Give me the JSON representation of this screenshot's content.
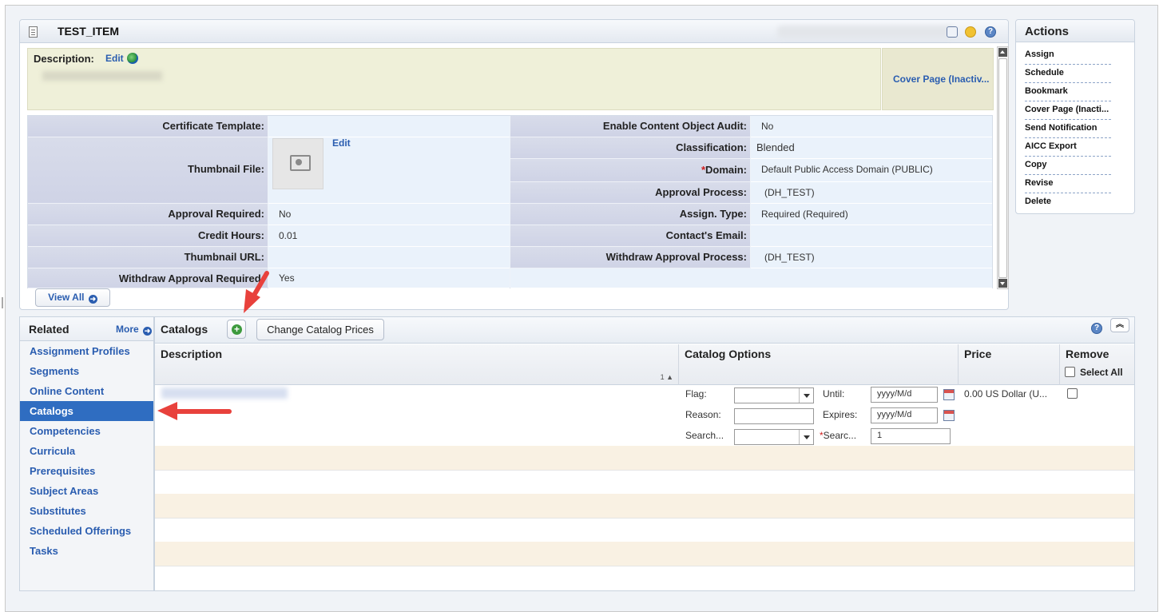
{
  "header": {
    "title": "TEST_ITEM",
    "icons": [
      "list-view-icon",
      "comment-icon",
      "help-icon"
    ]
  },
  "description": {
    "label": "Description:",
    "edit": "Edit",
    "cover_page": "Cover Page (Inactiv..."
  },
  "fields": {
    "certificate_template": {
      "label": "Certificate Template:",
      "value": ""
    },
    "thumbnail_file": {
      "label": "Thumbnail File:",
      "edit": "Edit"
    },
    "approval_required": {
      "label": "Approval Required:",
      "value": "No"
    },
    "credit_hours": {
      "label": "Credit Hours:",
      "value": "0.01"
    },
    "thumbnail_url": {
      "label": "Thumbnail URL:",
      "value": ""
    },
    "withdraw_approval_required": {
      "label": "Withdraw Approval Required:",
      "value": "Yes"
    },
    "enable_content_object_audit": {
      "label": "Enable Content Object Audit:",
      "value": "No"
    },
    "classification": {
      "label": "Classification:",
      "value": "Blended"
    },
    "domain": {
      "required_mark": "*",
      "label": "Domain:",
      "value": "Default Public Access Domain (PUBLIC)"
    },
    "approval_process": {
      "label": "Approval Process:",
      "value": "(DH_TEST)"
    },
    "assign_type": {
      "label": "Assign. Type:",
      "value": "Required (Required)"
    },
    "contacts_email": {
      "label": "Contact's Email:",
      "value": ""
    },
    "withdraw_approval_process": {
      "label": "Withdraw Approval Process:",
      "value": "(DH_TEST)"
    }
  },
  "view_all": "View All",
  "actions": {
    "title": "Actions",
    "items": [
      "Assign",
      "Schedule",
      "Bookmark",
      "Cover Page (Inacti...",
      "Send Notification",
      "AICC Export",
      "Copy",
      "Revise",
      "Delete"
    ]
  },
  "related": {
    "title": "Related",
    "more": "More",
    "items": [
      "Assignment Profiles",
      "Segments",
      "Online Content",
      "Catalogs",
      "Competencies",
      "Curricula",
      "Prerequisites",
      "Subject Areas",
      "Substitutes",
      "Scheduled Offerings",
      "Tasks"
    ],
    "active": "Catalogs"
  },
  "catalogs": {
    "title": "Catalogs",
    "change_prices": "Change Catalog Prices",
    "columns": {
      "description": "Description",
      "sort_indicator": "1 ▲",
      "options": "Catalog Options",
      "price": "Price",
      "remove": "Remove",
      "select_all": "Select All"
    },
    "row": {
      "flag_label": "Flag:",
      "until_label": "Until:",
      "until_placeholder": "yyyy/M/d",
      "reason_label": "Reason:",
      "expires_label": "Expires:",
      "expires_placeholder": "yyyy/M/d",
      "search_label": "Search...",
      "req_mark": "*",
      "search2_label": "Searc...",
      "search2_value": "1",
      "price": "0.00 US Dollar (U..."
    }
  },
  "colors": {
    "link": "#2a5db0",
    "active_bg": "#2f6dc1",
    "annotation": "#e8413c",
    "tan_row": "#f9f1e3"
  }
}
